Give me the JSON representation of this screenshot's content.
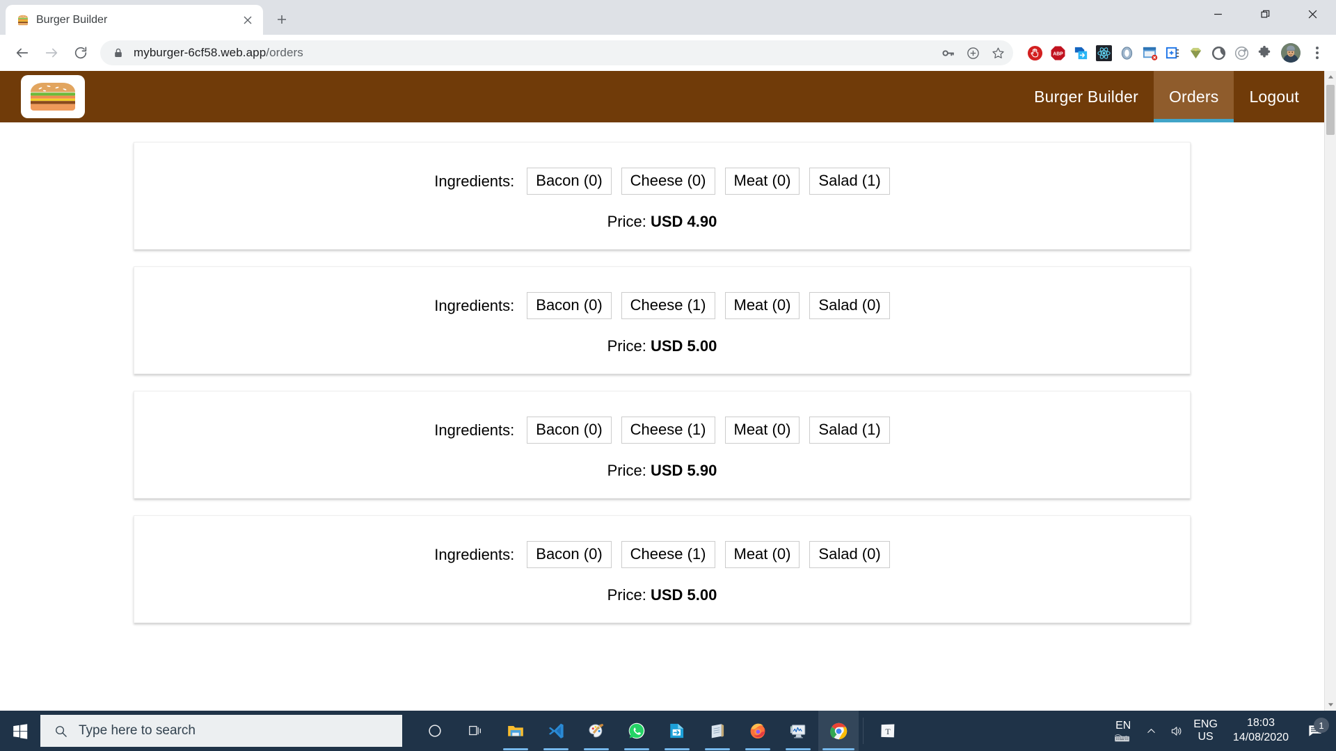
{
  "browser": {
    "tab": {
      "title": "Burger Builder",
      "favicon": "burger-icon"
    },
    "new_tab_label": "+",
    "window_controls": {
      "minimize": "minimize-icon",
      "restore": "restore-icon",
      "close": "close-icon"
    },
    "omnibox": {
      "url_host": "myburger-6cf58.web.app",
      "url_path": "/orders",
      "url_full": "myburger-6cf58.web.app/orders",
      "lock": "lock-icon"
    },
    "toolbar_icons": [
      "back-icon",
      "forward-icon",
      "reload-icon"
    ],
    "omnibox_actions": [
      "password-key-icon",
      "install-app-icon",
      "bookmark-star-icon"
    ],
    "extensions": [
      "ublock-origin-icon",
      "adblock-plus-icon",
      "blue-document-arrow-icon",
      "react-devtools-icon",
      "blue-droplet-icon",
      "window-block-icon",
      "grid-layout-icon",
      "green-diamond-icon",
      "dark-mode-moon-icon",
      "target-circle-icon",
      "puzzle-extensions-icon"
    ],
    "profile": "avatar",
    "menu": "three-dot-menu-icon"
  },
  "site": {
    "logo": "burger-logo",
    "nav": [
      {
        "label": "Burger Builder",
        "active": false
      },
      {
        "label": "Orders",
        "active": true
      },
      {
        "label": "Logout",
        "active": false
      }
    ]
  },
  "orders": {
    "ingredients_label": "Ingredients:",
    "price_label": "Price:",
    "items": [
      {
        "chips": [
          "Bacon (0)",
          "Cheese (0)",
          "Meat (0)",
          "Salad (1)"
        ],
        "price": "USD 4.90"
      },
      {
        "chips": [
          "Bacon (0)",
          "Cheese (1)",
          "Meat (0)",
          "Salad (0)"
        ],
        "price": "USD 5.00"
      },
      {
        "chips": [
          "Bacon (0)",
          "Cheese (1)",
          "Meat (0)",
          "Salad (1)"
        ],
        "price": "USD 5.90"
      },
      {
        "chips": [
          "Bacon (0)",
          "Cheese (1)",
          "Meat (0)",
          "Salad (0)"
        ],
        "price": "USD 5.00"
      }
    ]
  },
  "taskbar": {
    "start": "windows-start-icon",
    "search_placeholder": "Type here to search",
    "apps": [
      {
        "name": "cortana-icon",
        "state": "idle"
      },
      {
        "name": "task-view-icon",
        "state": "idle"
      },
      {
        "name": "file-explorer-icon",
        "state": "running"
      },
      {
        "name": "vscode-icon",
        "state": "running"
      },
      {
        "name": "paint-icon",
        "state": "running"
      },
      {
        "name": "whatsapp-icon",
        "state": "running"
      },
      {
        "name": "export-document-icon",
        "state": "running"
      },
      {
        "name": "notepad-icon",
        "state": "running"
      },
      {
        "name": "firefox-icon",
        "state": "running"
      },
      {
        "name": "task-manager-icon",
        "state": "running"
      },
      {
        "name": "chrome-icon",
        "state": "active"
      },
      {
        "name": "text-app-icon",
        "state": "idle"
      }
    ],
    "tray": {
      "lang_short": "EN",
      "keyboard_icon": "keyboard-icon",
      "chevron": "chevron-up-icon",
      "volume": "speaker-icon",
      "ime_lang": "ENG",
      "ime_region": "US",
      "time": "18:03",
      "date": "14/08/2020",
      "notifications_icon": "notification-icon",
      "notifications_count": "1"
    }
  },
  "colors": {
    "site_brown": "#703B09",
    "site_brown_active": "#8F5C2C",
    "accent_cyan": "#40A4C8",
    "taskbar": "#1f3348",
    "chrome_frame": "#dee1e6"
  }
}
